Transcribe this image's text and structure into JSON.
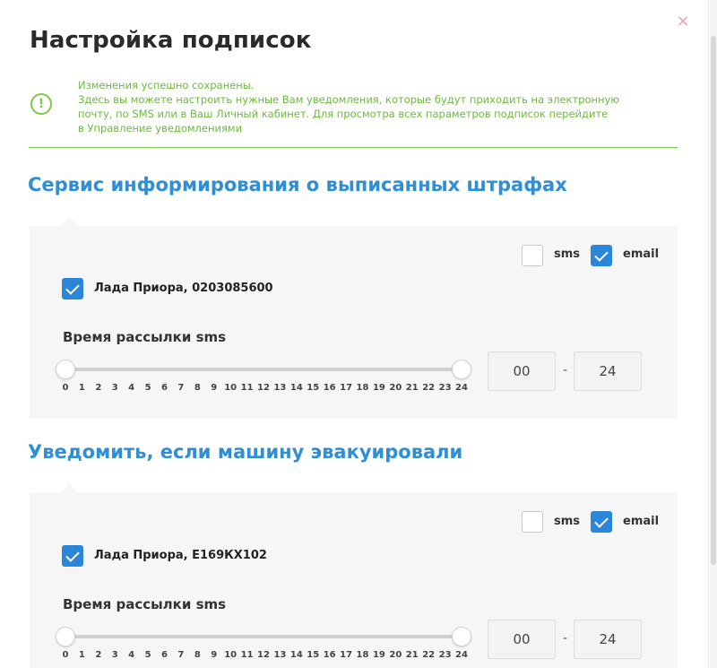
{
  "modal": {
    "title": "Настройка подписок",
    "close_symbol": "×"
  },
  "notice": {
    "icon": "exclamation-circle-icon",
    "line1": "Изменения успешно сохранены.",
    "line2": "Здесь вы можете настроить нужные Вам уведомления, которые будут приходить на электронную",
    "line3": "почту, по SMS или в Ваш Личный кабинет. Для просмотра всех параметров подписок перейдите",
    "line4": "в Управление уведомлениями",
    "color": "#7fc64e"
  },
  "sections": [
    {
      "title": "Сервис информирования о выписанных штрафах",
      "sms_label": "sms",
      "sms_checked": false,
      "email_label": "email",
      "email_checked": true,
      "car_label": "Лада Приора, 0203085600",
      "car_checked": true,
      "time_label": "Время рассылки sms",
      "range_min": 0,
      "range_max": 24,
      "from_value": "00",
      "to_value": "24",
      "dash": "-"
    },
    {
      "title": "Уведомить, если машину эвакуировали",
      "sms_label": "sms",
      "sms_checked": false,
      "email_label": "email",
      "email_checked": true,
      "car_label": "Лада Приора, Е169КХ102",
      "car_checked": true,
      "time_label": "Время рассылки sms",
      "range_min": 0,
      "range_max": 24,
      "from_value": "00",
      "to_value": "24",
      "dash": "-"
    }
  ],
  "ticks": [
    "0",
    "1",
    "2",
    "3",
    "4",
    "5",
    "6",
    "7",
    "8",
    "9",
    "10",
    "11",
    "12",
    "13",
    "14",
    "15",
    "16",
    "17",
    "18",
    "19",
    "20",
    "21",
    "22",
    "23",
    "24"
  ],
  "colors": {
    "accent": "#2a86d9",
    "section_title": "#2e8fd6",
    "success": "#6cbb3c",
    "close": "#f0a0a8"
  }
}
